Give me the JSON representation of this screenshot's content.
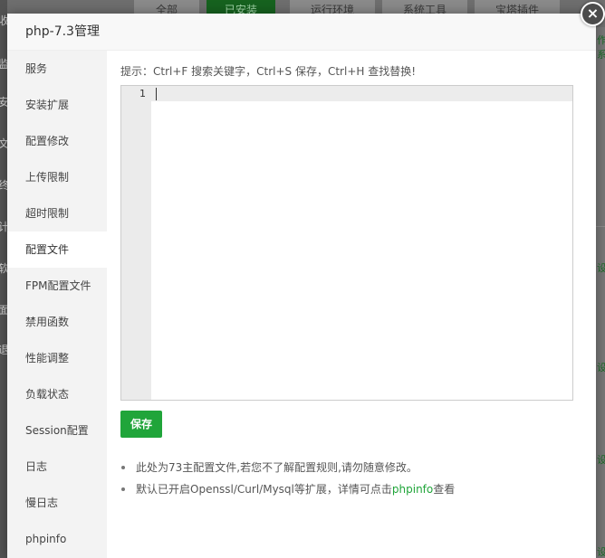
{
  "background": {
    "tabs": [
      {
        "label": "全部",
        "active": false
      },
      {
        "label": "已安装",
        "active": true
      },
      {
        "label": "运行环境",
        "active": false
      },
      {
        "label": "系统工具",
        "active": false
      },
      {
        "label": "宝塔插件",
        "active": false
      }
    ],
    "left_chars": [
      "收",
      "监",
      "安",
      "文",
      "终",
      "计",
      "软",
      "面",
      "退"
    ],
    "right_chars": [
      "作系",
      "设",
      "设",
      "设",
      "设"
    ]
  },
  "modal": {
    "title": "php-7.3管理",
    "close_icon": "×"
  },
  "sidebar": {
    "items": [
      {
        "label": "服务",
        "active": false
      },
      {
        "label": "安装扩展",
        "active": false
      },
      {
        "label": "配置修改",
        "active": false
      },
      {
        "label": "上传限制",
        "active": false
      },
      {
        "label": "超时限制",
        "active": false
      },
      {
        "label": "配置文件",
        "active": true
      },
      {
        "label": "FPM配置文件",
        "active": false
      },
      {
        "label": "禁用函数",
        "active": false
      },
      {
        "label": "性能调整",
        "active": false
      },
      {
        "label": "负载状态",
        "active": false
      },
      {
        "label": "Session配置",
        "active": false
      },
      {
        "label": "日志",
        "active": false
      },
      {
        "label": "慢日志",
        "active": false
      },
      {
        "label": "phpinfo",
        "active": false
      }
    ]
  },
  "editor": {
    "hint": "提示：Ctrl+F 搜索关键字，Ctrl+S 保存，Ctrl+H 查找替换!",
    "line_number": "1",
    "content": ""
  },
  "save_label": "保存",
  "notes": {
    "note1": "此处为73主配置文件,若您不了解配置规则,请勿随意修改。",
    "note2_prefix": "默认已开启Openssl/Curl/Mysql等扩展，详情可点击",
    "note2_link": "phpinfo",
    "note2_suffix": "查看"
  },
  "colors": {
    "accent": "#20a53a",
    "sidebar_bg": "#f3f3f3",
    "header_bg": "#f8f8f8"
  }
}
